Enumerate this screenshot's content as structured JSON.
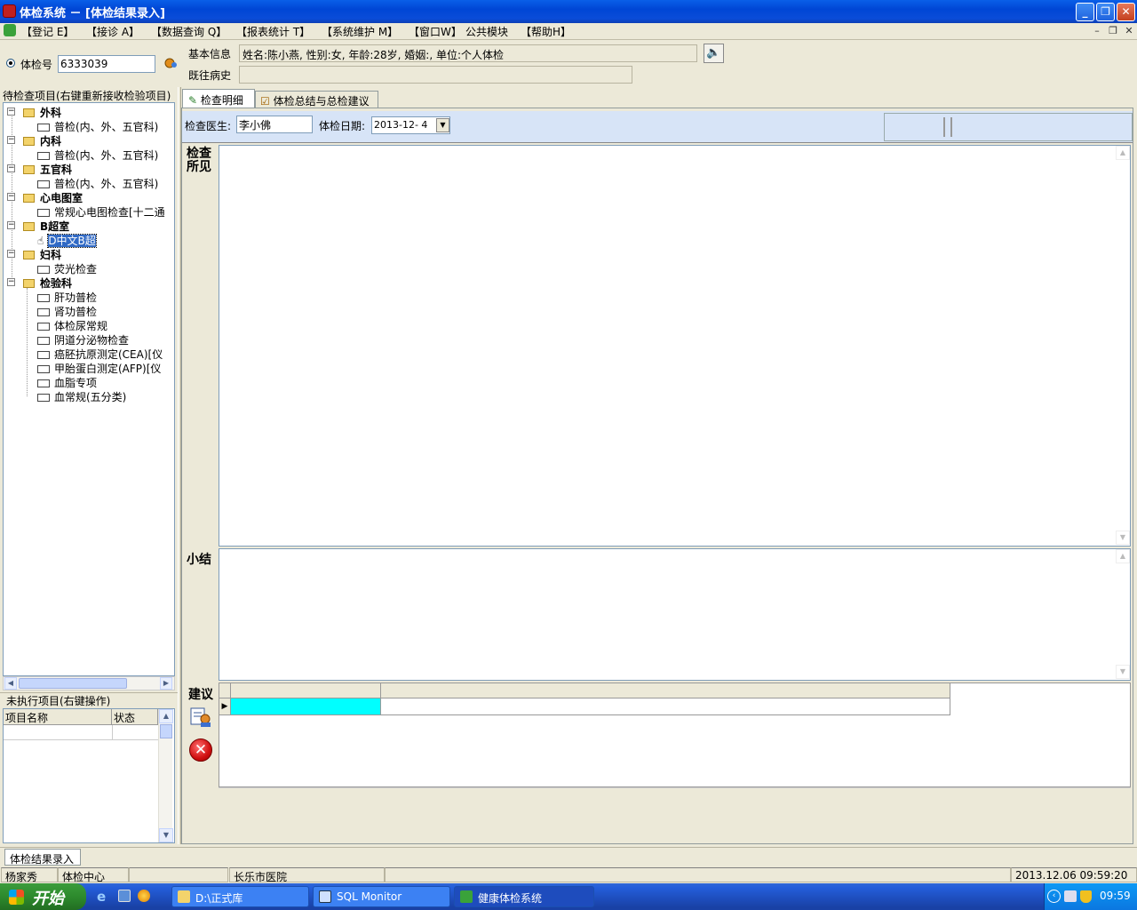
{
  "window": {
    "title": "体检系统 － [体检结果录入]"
  },
  "menu": [
    "【登记 E】",
    "【接诊 A】",
    "【数据查询 Q】",
    "【报表统计 T】",
    "【系统维护 M】",
    "【窗口W】",
    "公共模块",
    "【帮助H】"
  ],
  "exam": {
    "radio_label": "体检号",
    "exam_no": "6333039"
  },
  "info": {
    "basic_label": "基本信息",
    "basic_value": "姓名:陈小燕, 性别:女, 年龄:28岁, 婚姻:, 单位:个人体检",
    "history_label": "既往病史",
    "history_value": ""
  },
  "pending": {
    "header": "待检查项目(右键重新接收检验项目)"
  },
  "tree": [
    {
      "label": "外科",
      "level": 0
    },
    {
      "label": "普检(内、外、五官科)",
      "level": 1
    },
    {
      "label": "内科",
      "level": 0
    },
    {
      "label": "普检(内、外、五官科)",
      "level": 1
    },
    {
      "label": "五官科",
      "level": 0
    },
    {
      "label": "普检(内、外、五官科)",
      "level": 1
    },
    {
      "label": "心电图室",
      "level": 0
    },
    {
      "label": "常规心电图检查[十二通",
      "level": 1
    },
    {
      "label": "B超室",
      "level": 0
    },
    {
      "label": "D中文B超",
      "level": 1,
      "selected": true
    },
    {
      "label": "妇科",
      "level": 0
    },
    {
      "label": "荧光检查",
      "level": 1
    },
    {
      "label": "检验科",
      "level": 0
    },
    {
      "label": "肝功普检",
      "level": 1
    },
    {
      "label": "肾功普检",
      "level": 1
    },
    {
      "label": "体检尿常规",
      "level": 1
    },
    {
      "label": "阴道分泌物检查",
      "level": 1
    },
    {
      "label": "癌胚抗原测定(CEA)[仪",
      "level": 1
    },
    {
      "label": "甲胎蛋白测定(AFP)[仪",
      "level": 1
    },
    {
      "label": "血脂专项",
      "level": 1
    },
    {
      "label": "血常规(五分类)",
      "level": 1
    }
  ],
  "unexec": {
    "header": "未执行项目(右键操作)",
    "col_name": "项目名称",
    "col_status": "状态"
  },
  "tabs": [
    {
      "label": "检查明细",
      "active": true
    },
    {
      "label": "体检总结与总检建议",
      "active": false
    }
  ],
  "detail": {
    "doctor_label": "检查医生:",
    "doctor_value": "李小佛",
    "date_label": "体检日期:",
    "date_value": "2013-12- 4",
    "findings_label": "检查所见",
    "summary_label": "小结",
    "advice_label": "建议"
  },
  "status": {
    "tab": "体检结果录入",
    "user": "杨家秀",
    "dept": "体检中心",
    "hospital": "长乐市医院",
    "datetime": "2013.12.06 09:59:20"
  },
  "taskbar": {
    "start": "开始",
    "tasks": [
      "D:\\正式库",
      "SQL Monitor",
      "健康体检系统"
    ],
    "clock": "09:59"
  }
}
